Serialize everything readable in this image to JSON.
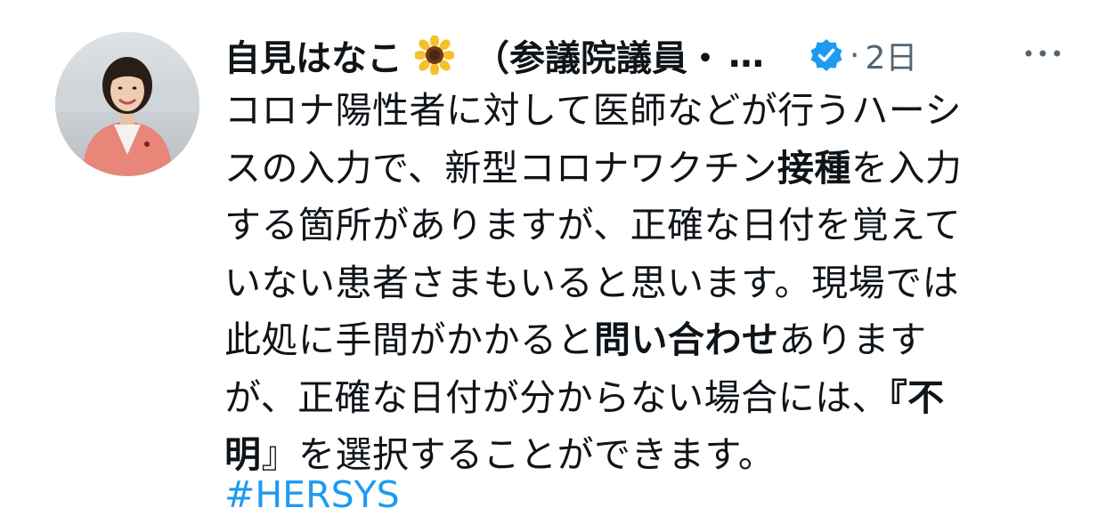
{
  "author": {
    "display_name": "自見はなこ",
    "name_suffix": "（参議院議員・",
    "ellipsis": "…",
    "emoji_icon": "sunflower-icon",
    "verified_icon": "verified-badge-icon"
  },
  "meta": {
    "separator": "·",
    "timestamp": "2日",
    "more_icon": "more-horizontal-icon"
  },
  "tweet": {
    "lines": [
      [
        {
          "t": "コロナ陽性者に対して医師などが行うハーシ",
          "b": false
        }
      ],
      [
        {
          "t": "スの入力で、新型コロナワクチン",
          "b": false
        },
        {
          "t": "接種",
          "b": true
        },
        {
          "t": "を入力",
          "b": false
        }
      ],
      [
        {
          "t": "する箇所がありますが、正確な日付を覚えて",
          "b": false
        }
      ],
      [
        {
          "t": "いない患者さまもいると思います。現場では",
          "b": false
        }
      ],
      [
        {
          "t": "此処に手間がかかると",
          "b": false
        },
        {
          "t": "問い合わせ",
          "b": true
        },
        {
          "t": "あります",
          "b": false
        }
      ],
      [
        {
          "t": "が、正確な日付が分からない場合には、",
          "b": false
        },
        {
          "t": "『不",
          "b": true
        }
      ],
      [
        {
          "t": "明",
          "b": true
        },
        {
          "t": "』を選択することができます。",
          "b": false
        }
      ]
    ],
    "hashtag": "#HERSYS"
  },
  "colors": {
    "text": "#0f1419",
    "muted": "#536471",
    "link": "#1d9bf0",
    "verified": "#1d9bf0"
  }
}
